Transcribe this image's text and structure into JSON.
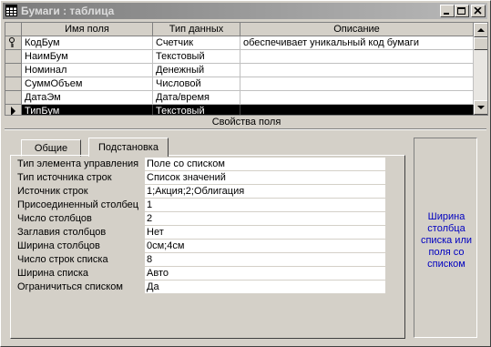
{
  "window": {
    "title": "Бумаги : таблица",
    "buttons": {
      "minimize": "minimize-icon",
      "maximize": "maximize-icon",
      "close": "close-icon"
    }
  },
  "grid": {
    "headers": {
      "name": "Имя поля",
      "type": "Тип данных",
      "description": "Описание"
    },
    "rows": [
      {
        "name": "КодБум",
        "type": "Счетчик",
        "description": "обеспечивает уникальный код бумаги",
        "key": true
      },
      {
        "name": "НаимБум",
        "type": "Текстовый",
        "description": ""
      },
      {
        "name": "Номинал",
        "type": "Денежный",
        "description": ""
      },
      {
        "name": "СуммОбъем",
        "type": "Числовой",
        "description": ""
      },
      {
        "name": "ДатаЭм",
        "type": "Дата/время",
        "description": ""
      },
      {
        "name": "ТипБум",
        "type": "Текстовый",
        "description": "",
        "selected": true
      }
    ]
  },
  "properties": {
    "section_title": "Свойства поля",
    "tabs": {
      "general": "Общие",
      "lookup": "Подстановка"
    },
    "items": [
      {
        "label": "Тип элемента управления",
        "value": "Поле со списком"
      },
      {
        "label": "Тип источника строк",
        "value": "Список значений"
      },
      {
        "label": "Источник строк",
        "value": "1;Акция;2;Облигация"
      },
      {
        "label": "Присоединенный столбец",
        "value": "1"
      },
      {
        "label": "Число столбцов",
        "value": "2"
      },
      {
        "label": "Заглавия столбцов",
        "value": "Нет"
      },
      {
        "label": "Ширина столбцов",
        "value": "0см;4см"
      },
      {
        "label": "Число строк списка",
        "value": "8"
      },
      {
        "label": "Ширина списка",
        "value": "Авто"
      },
      {
        "label": "Ограничиться списком",
        "value": "Да"
      }
    ],
    "help_text": "Ширина столбца списка или поля со списком"
  },
  "colors": {
    "help_text": "#0000c0",
    "selected_row": "#000000",
    "titlebar": "#7b7b7b"
  }
}
